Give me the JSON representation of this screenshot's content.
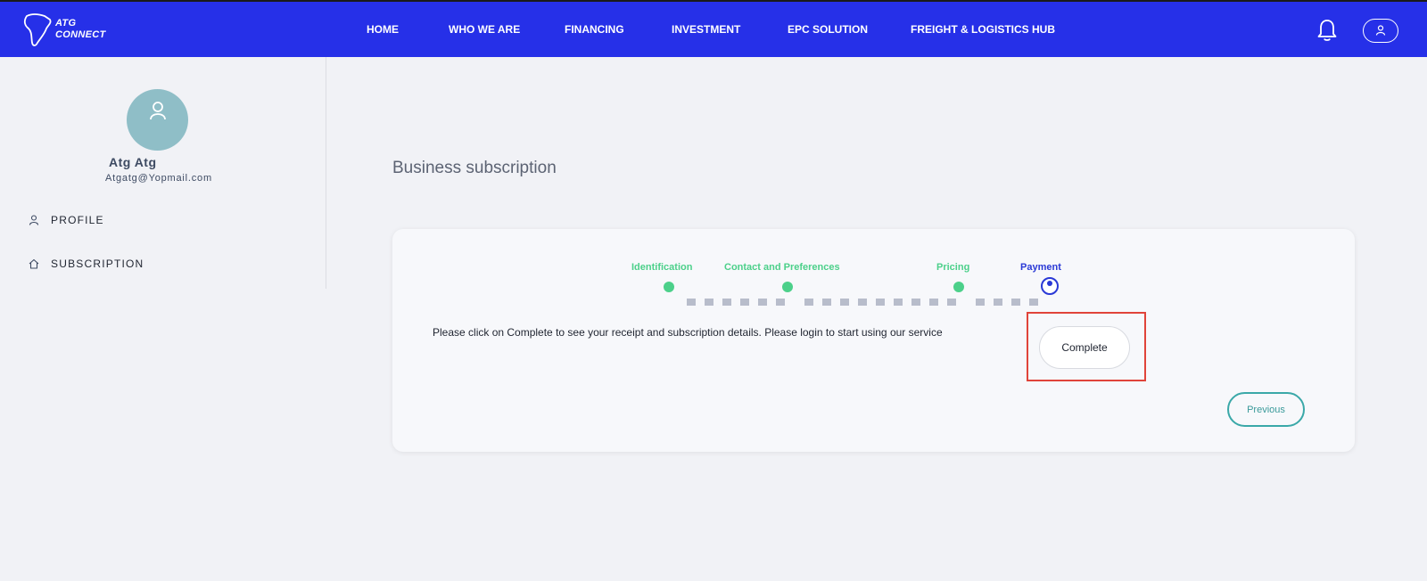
{
  "brand": {
    "line1": "ATG",
    "line2": "CONNECT"
  },
  "nav": {
    "items": [
      {
        "label": "HOME"
      },
      {
        "label": "WHO WE ARE"
      },
      {
        "label": "FINANCING"
      },
      {
        "label": "INVESTMENT"
      },
      {
        "label": "EPC SOLUTION"
      },
      {
        "label": "FREIGHT & LOGISTICS HUB"
      }
    ],
    "bell_icon": "bell-icon",
    "user_icon": "user-icon"
  },
  "sidebar": {
    "user_name": "Atg Atg",
    "user_email": "Atgatg@Yopmail.com",
    "items": [
      {
        "label": "PROFILE",
        "icon": "user-icon"
      },
      {
        "label": "SUBSCRIPTION",
        "icon": "home-icon"
      }
    ]
  },
  "main": {
    "title": "Business subscription",
    "steps": [
      {
        "label": "Identification",
        "status": "done"
      },
      {
        "label": "Contact and Preferences",
        "status": "done"
      },
      {
        "label": "Pricing",
        "status": "done"
      },
      {
        "label": "Payment",
        "status": "active"
      }
    ],
    "message": "Please click on Complete to see your receipt and subscription details. Please login to start using our service",
    "complete_label": "Complete",
    "previous_label": "Previous"
  },
  "colors": {
    "nav_bg": "#2630e8",
    "step_done": "#4cd08a",
    "step_active": "#2a39d6",
    "previous_border": "#3aa8a8",
    "highlight": "#e0443a"
  }
}
